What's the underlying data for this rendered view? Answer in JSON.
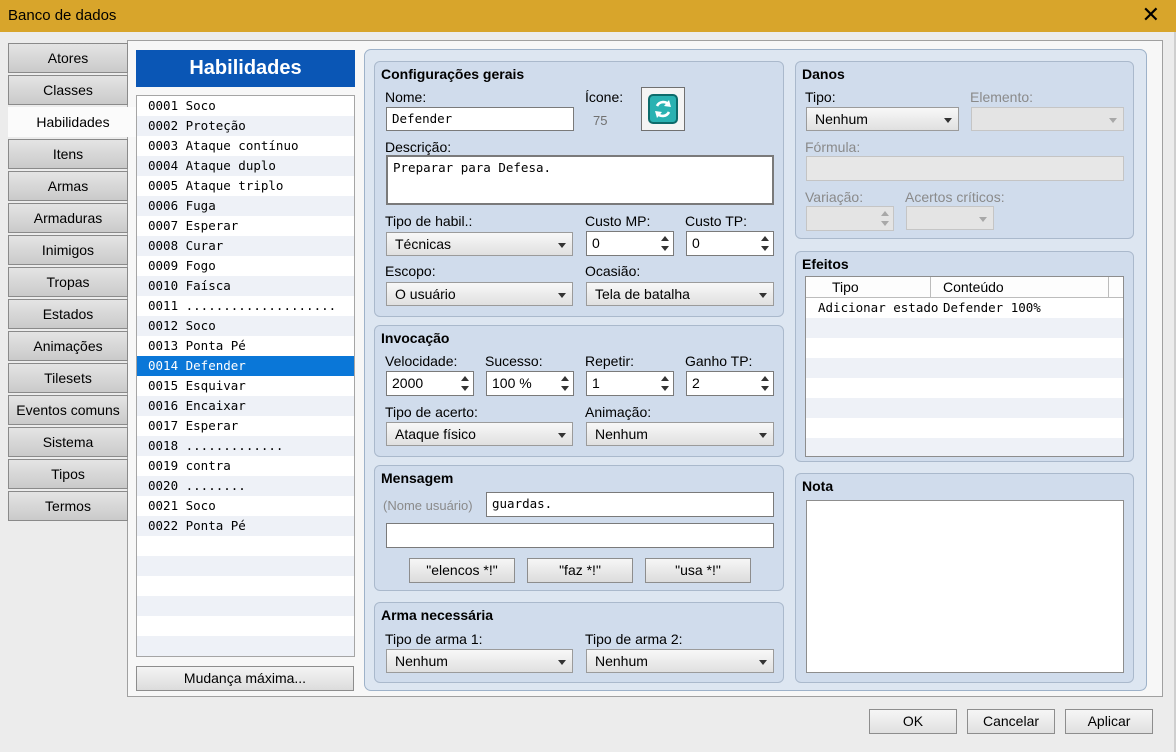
{
  "window": {
    "title": "Banco de dados",
    "close_glyph": "✕"
  },
  "tabs": [
    "Atores",
    "Classes",
    "Habilidades",
    "Itens",
    "Armas",
    "Armaduras",
    "Inimigos",
    "Tropas",
    "Estados",
    "Animações",
    "Tilesets",
    "Eventos comuns",
    "Sistema",
    "Tipos",
    "Termos"
  ],
  "list": {
    "header": "Habilidades",
    "items": [
      "0001 Soco",
      "0002 Proteção",
      "0003 Ataque contínuo",
      "0004 Ataque duplo",
      "0005 Ataque triplo",
      "0006 Fuga",
      "0007 Esperar",
      "0008 Curar",
      "0009 Fogo",
      "0010 Faísca",
      "0011 ....................",
      "0012 Soco",
      "0013 Ponta Pé",
      "0014 Defender",
      "0015 Esquivar",
      "0016 Encaixar",
      "0017 Esperar",
      "0018 .............",
      "0019 contra",
      "0020 ........",
      "0021 Soco",
      "0022 Ponta Pé"
    ],
    "max_change": "Mudança máxima..."
  },
  "general": {
    "title": "Configurações gerais",
    "name_label": "Nome:",
    "name_value": "Defender",
    "icon_label": "Ícone:",
    "icon_index": "75",
    "description_label": "Descrição:",
    "description_value": "Preparar para Defesa.",
    "skill_type_label": "Tipo de habil.:",
    "skill_type_value": "Técnicas",
    "mp_cost_label": "Custo MP:",
    "mp_cost_value": "0",
    "tp_cost_label": "Custo TP:",
    "tp_cost_value": "0",
    "scope_label": "Escopo:",
    "scope_value": "O usuário",
    "occasion_label": "Ocasião:",
    "occasion_value": "Tela de batalha"
  },
  "invocation": {
    "title": "Invocação",
    "speed_label": "Velocidade:",
    "speed_value": "2000",
    "success_label": "Sucesso:",
    "success_value": "100 %",
    "repeat_label": "Repetir:",
    "repeat_value": "1",
    "tp_gain_label": "Ganho TP:",
    "tp_gain_value": "2",
    "hit_type_label": "Tipo de acerto:",
    "hit_type_value": "Ataque físico",
    "animation_label": "Animação:",
    "animation_value": "Nenhum"
  },
  "message": {
    "title": "Mensagem",
    "user_name_label": "(Nome usuário)",
    "line1_value": "guardas.",
    "line2_value": "",
    "buttons": [
      "\"elencos *!\"",
      "\"faz *!\"",
      "\"usa *!\""
    ]
  },
  "weapon_req": {
    "title": "Arma necessária",
    "type1_label": "Tipo de arma 1:",
    "type1_value": "Nenhum",
    "type2_label": "Tipo de arma 2:",
    "type2_value": "Nenhum"
  },
  "damage": {
    "title": "Danos",
    "type_label": "Tipo:",
    "type_value": "Nenhum",
    "element_label": "Elemento:",
    "element_value": "",
    "formula_label": "Fórmula:",
    "formula_value": "",
    "variance_label": "Variação:",
    "variance_value": "",
    "critical_label": "Acertos críticos:",
    "critical_value": ""
  },
  "effects": {
    "title": "Efeitos",
    "columns": [
      "Tipo",
      "Conteúdo"
    ],
    "rows": [
      {
        "type": "Adicionar estado",
        "content": "Defender 100%"
      }
    ]
  },
  "note": {
    "title": "Nota",
    "value": ""
  },
  "dialog": {
    "ok": "OK",
    "cancel": "Cancelar",
    "apply": "Aplicar"
  },
  "colors": {
    "titlebar": "#d8a52b",
    "list_header": "#0a56b5",
    "selection": "#0a77d8",
    "panel": "#d0dcec",
    "icon_teal": "#2ab2b2"
  },
  "icons": {
    "close": "close-icon",
    "skill_icon": "refresh-icon"
  }
}
